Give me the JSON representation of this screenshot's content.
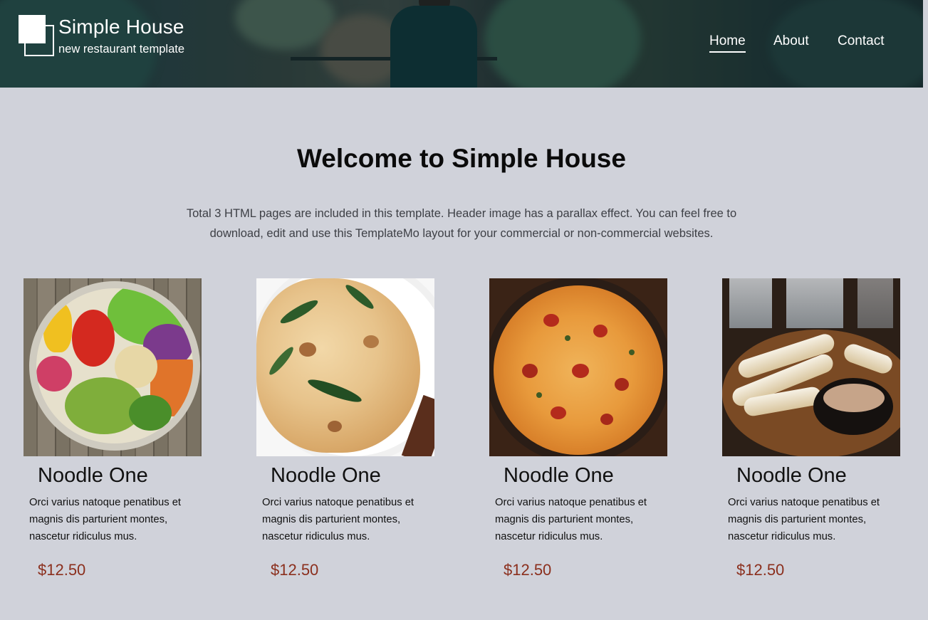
{
  "header": {
    "title": "Simple House",
    "tagline": "new restaurant template",
    "nav": [
      {
        "label": "Home",
        "active": true
      },
      {
        "label": "About",
        "active": false
      },
      {
        "label": "Contact",
        "active": false
      }
    ]
  },
  "welcome": {
    "title": "Welcome to Simple House",
    "text": "Total 3 HTML pages are included in this template. Header image has a parallax effect. You can feel free to download, edit and use this TemplateMo layout for your commercial or non-commercial websites."
  },
  "items": [
    {
      "image": "salad-bowl-photo",
      "name": "Noodle One",
      "description": "Orci varius natoque penatibus et magnis dis parturient montes, nascetur ridiculus mus.",
      "price": "$12.50"
    },
    {
      "image": "pasta-plate-photo",
      "name": "Noodle One",
      "description": "Orci varius natoque penatibus et magnis dis parturient montes, nascetur ridiculus mus.",
      "price": "$12.50"
    },
    {
      "image": "pizza-photo",
      "name": "Noodle One",
      "description": "Orci varius natoque penatibus et magnis dis parturient montes, nascetur ridiculus mus.",
      "price": "$12.50"
    },
    {
      "image": "calamari-photo",
      "name": "Noodle One",
      "description": "Orci varius natoque penatibus et magnis dis parturient montes, nascetur ridiculus mus.",
      "price": "$12.50"
    }
  ],
  "colors": {
    "page_background": "#d0d2da",
    "price": "#8b2f1d",
    "header_text": "#ffffff"
  }
}
